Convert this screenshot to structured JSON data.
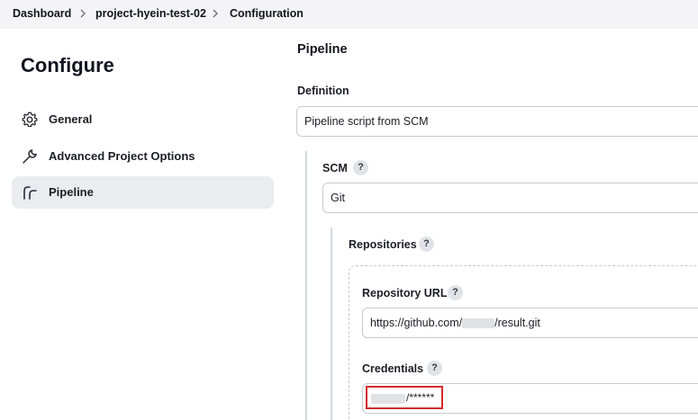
{
  "breadcrumb": {
    "items": [
      "Dashboard",
      "project-hyein-test-02",
      "Configuration"
    ]
  },
  "sidebar": {
    "title": "Configure",
    "items": [
      {
        "label": "General",
        "icon": "gear-icon"
      },
      {
        "label": "Advanced Project Options",
        "icon": "wrench-icon"
      },
      {
        "label": "Pipeline",
        "icon": "pipeline-icon",
        "active": true
      }
    ]
  },
  "main": {
    "section_title": "Pipeline",
    "definition": {
      "label": "Definition",
      "value": "Pipeline script from SCM"
    },
    "scm": {
      "label": "SCM",
      "help": "?",
      "value": "Git"
    },
    "repositories": {
      "label": "Repositories",
      "help": "?",
      "url_label": "Repository URL",
      "url_help": "?",
      "url_prefix": "https://github.com/",
      "url_suffix": "/result.git",
      "credentials_label": "Credentials",
      "credentials_help": "?",
      "credentials_suffix": "/******"
    }
  },
  "colors": {
    "highlight_border": "#d22b2b",
    "active_bg": "#ebecf0",
    "breadcrumb_bg": "#f4f4f6"
  }
}
